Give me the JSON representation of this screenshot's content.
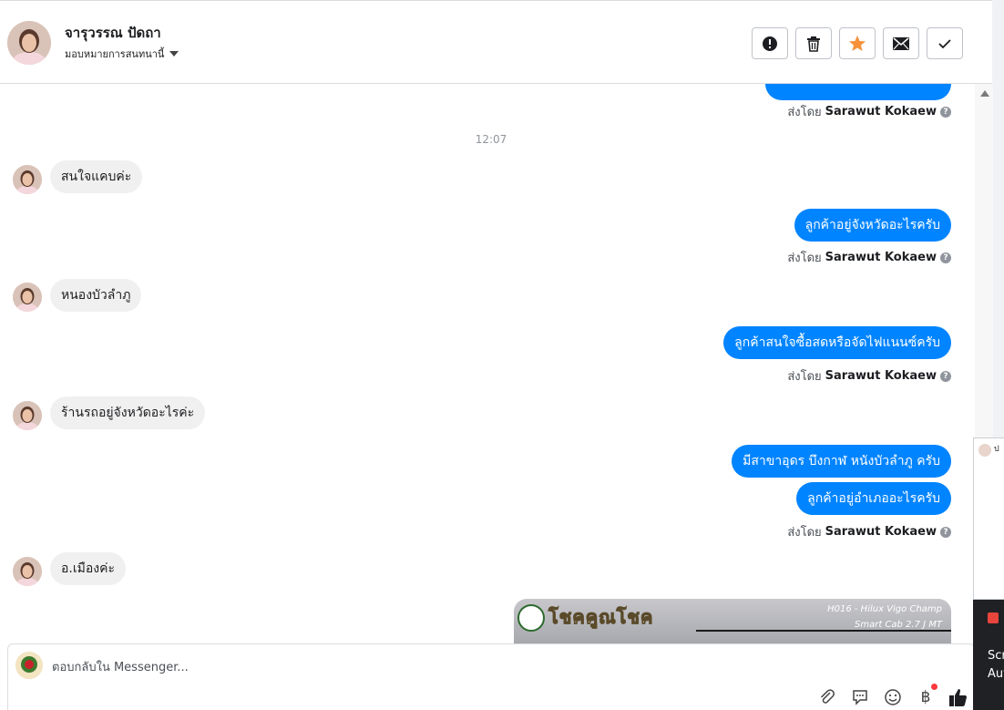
{
  "header": {
    "name": "จารุวรรณ ปัดถา",
    "assign_label": "มอบหมายการสนทนานี้"
  },
  "chat": {
    "partial_sent_by": {
      "prefix": "ส่งโดย",
      "name": "Sarawut Kokaew"
    },
    "timestamp": "12:07",
    "messages": [
      {
        "in": "สนใจแคบค่ะ"
      },
      {
        "out": "ลูกค้าอยู่จังหวัดอะไรครับ",
        "sent_by_prefix": "ส่งโดย",
        "sent_by_name": "Sarawut Kokaew"
      },
      {
        "in": "หนองบัวลำภู"
      },
      {
        "out": "ลูกค้าสนใจซื้อสดหรือจัดไฟแนนซ์ครับ",
        "sent_by_prefix": "ส่งโดย",
        "sent_by_name": "Sarawut Kokaew"
      },
      {
        "in": "ร้านรถอยู่จังหวัดอะไรค่ะ"
      },
      {
        "out1": "มีสาขาอุดร บึงกาฬ หนังบัวลำภู ครับ",
        "out2": "ลูกค้าอยู่อำเภออะไรครับ",
        "sent_by_prefix": "ส่งโดย",
        "sent_by_name": "Sarawut Kokaew"
      },
      {
        "in": "อ.เมืองค่ะ"
      }
    ],
    "image_card": {
      "brand": "โชคคูณโชค",
      "model_line1": "H016 - Hilux Vigo Champ",
      "model_line2": "Smart Cab 2.7 J MT"
    }
  },
  "composer": {
    "placeholder": "ตอบกลับใน Messenger..."
  },
  "popup": {
    "dark_line1": "Scr",
    "dark_line2": "Aut"
  },
  "colors": {
    "accent_blue": "#0084ff",
    "incoming_bubble": "#f1f0f0",
    "star_orange": "#f7923a"
  },
  "icons": [
    "alert-icon",
    "trash-icon",
    "star-icon",
    "mail-icon",
    "check-icon",
    "attach-icon",
    "saved-reply-icon",
    "emoji-icon",
    "baht-icon",
    "like-icon"
  ]
}
